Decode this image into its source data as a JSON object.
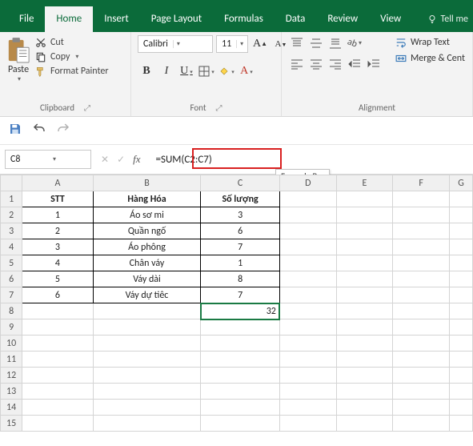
{
  "menu": {
    "file": "File",
    "home": "Home",
    "insert": "Insert",
    "pagelayout": "Page Layout",
    "formulas": "Formulas",
    "data": "Data",
    "review": "Review",
    "view": "View",
    "tellme": "Tell me"
  },
  "clipboard": {
    "paste": "Paste",
    "cut": "Cut",
    "copy": "Copy",
    "fmtpainter": "Format Painter",
    "group_label": "Clipboard"
  },
  "font": {
    "name": "Calibri",
    "size": "11",
    "group_label": "Font"
  },
  "alignment": {
    "wrap": "Wrap Text",
    "merge": "Merge & Cent",
    "group_label": "Alignment"
  },
  "namebox": "C8",
  "formula": "=SUM(C2:C7)",
  "tooltip": "Formula Bar",
  "headers": [
    "A",
    "B",
    "C",
    "D",
    "E",
    "F",
    "G"
  ],
  "table": {
    "cols": [
      "STT",
      "Hàng Hóa",
      "Số lượng"
    ],
    "rows": [
      {
        "stt": "1",
        "name": "Áo sơ mi",
        "qty": "3"
      },
      {
        "stt": "2",
        "name": "Quần ngố",
        "qty": "6"
      },
      {
        "stt": "3",
        "name": "Áo phông",
        "qty": "7"
      },
      {
        "stt": "4",
        "name": "Chân váy",
        "qty": "1"
      },
      {
        "stt": "5",
        "name": "Váy dài",
        "qty": "8"
      },
      {
        "stt": "6",
        "name": "Váy dự tiêc",
        "qty": "7"
      }
    ],
    "sum": "32"
  },
  "chart_data": {
    "type": "table",
    "title": "",
    "columns": [
      "STT",
      "Hàng Hóa",
      "Số lượng"
    ],
    "rows": [
      [
        1,
        "Áo sơ mi",
        3
      ],
      [
        2,
        "Quần ngố",
        6
      ],
      [
        3,
        "Áo phông",
        7
      ],
      [
        4,
        "Chân váy",
        1
      ],
      [
        5,
        "Váy dài",
        8
      ],
      [
        6,
        "Váy dự tiêc",
        7
      ]
    ],
    "aggregate": {
      "label": "SUM(C2:C7)",
      "value": 32
    }
  }
}
